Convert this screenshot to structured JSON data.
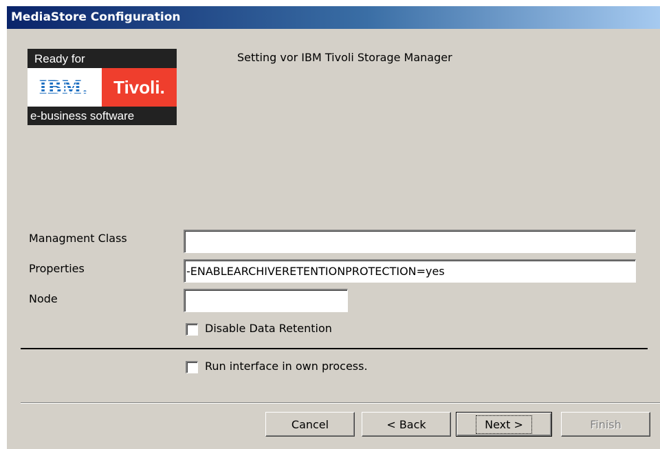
{
  "window": {
    "title": "MediaStore Configuration"
  },
  "logo": {
    "top": "Ready for",
    "ibm": "IBM.",
    "tivoli": "Tivoli.",
    "bottom": "e-business software"
  },
  "heading": "Setting vor IBM Tivoli Storage Manager",
  "form": {
    "management_class_label": "Managment Class",
    "management_class_value": "",
    "properties_label": "Properties",
    "properties_value": "-ENABLEARCHIVERETENTIONPROTECTION=yes",
    "node_label": "Node",
    "node_value": "",
    "disable_retention_label": "Disable Data Retention",
    "disable_retention_checked": false,
    "run_own_process_label": "Run interface in own process.",
    "run_own_process_checked": false
  },
  "buttons": {
    "cancel": "Cancel",
    "back": "< Back",
    "next": "Next >",
    "finish": "Finish"
  }
}
